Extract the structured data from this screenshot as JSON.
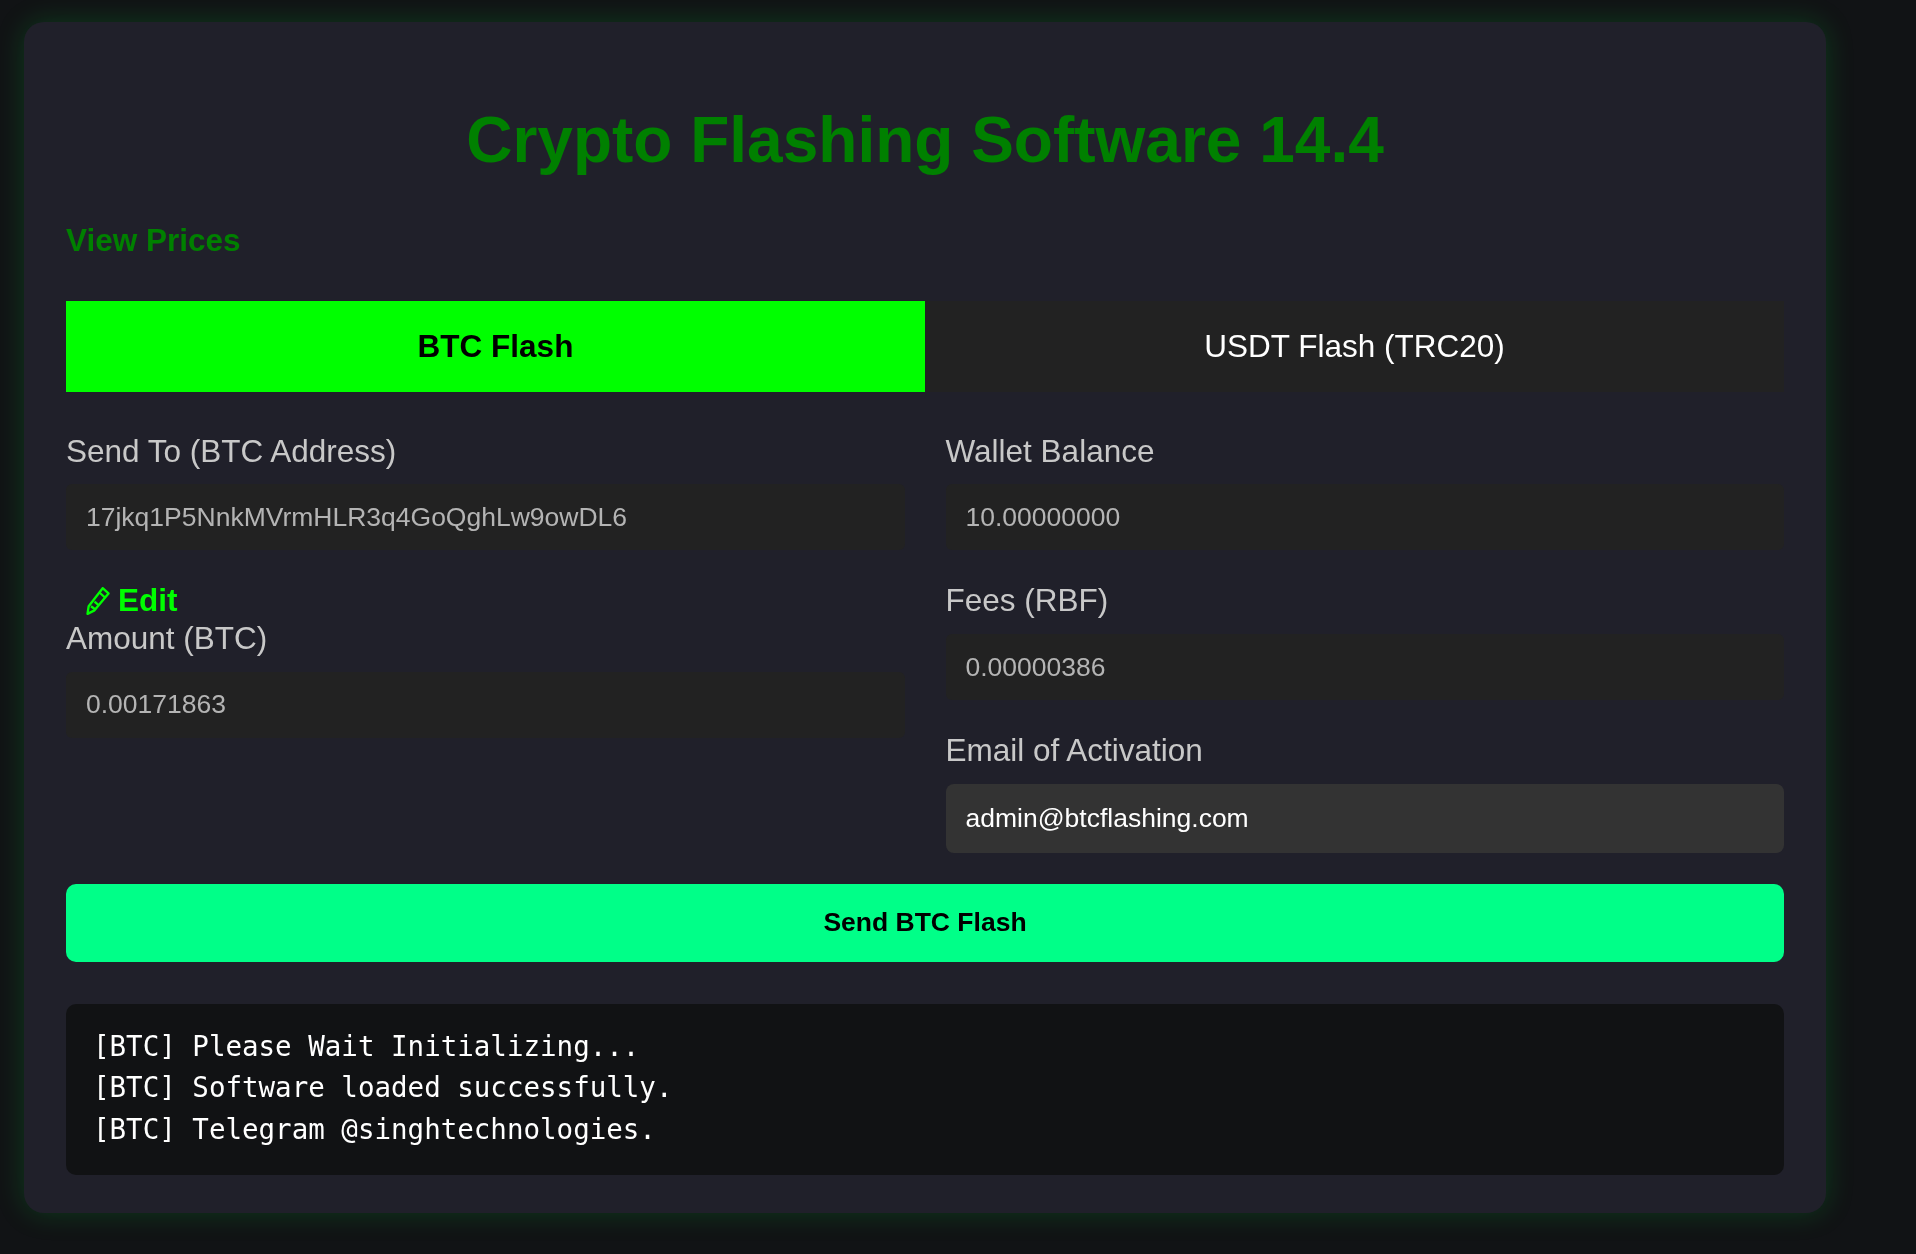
{
  "title": "Crypto Flashing Software 14.4",
  "prices_link": "View Prices",
  "tabs": [
    {
      "label": "BTC Flash",
      "selected": true
    },
    {
      "label": "USDT Flash (TRC20)",
      "selected": false
    }
  ],
  "form": {
    "columns": [
      {
        "items": [
          {
            "kind": "field",
            "label": "Send To (BTC Address)",
            "value": "17jkq1P5NnkMVrmHLR3q4GoQghLw9owDL6",
            "readonly": true
          },
          {
            "kind": "link",
            "label": "Edit"
          },
          {
            "kind": "field",
            "label": "Amount (BTC)",
            "value": "0.00171863",
            "readonly": true
          }
        ]
      },
      {
        "items": [
          {
            "kind": "field",
            "label": "Wallet Balance",
            "value": "10.00000000",
            "readonly": true
          },
          {
            "kind": "field",
            "label": "Fees (RBF)",
            "value": "0.00000386",
            "readonly": true
          },
          {
            "kind": "field",
            "label": "Email of Activation",
            "value": "admin@btcflashing.com",
            "readonly": false
          }
        ]
      }
    ]
  },
  "send_button": "Send BTC Flash",
  "console_lines": [
    "[BTC] Please Wait Initializing...",
    "[BTC] Software loaded successfully.",
    "[BTC] Telegram @singhtechnologies."
  ]
}
